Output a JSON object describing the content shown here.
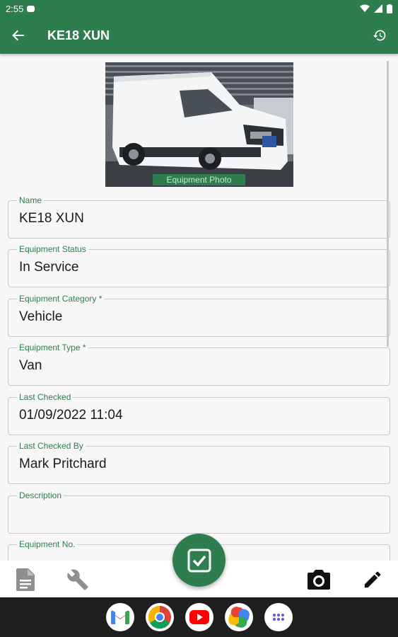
{
  "status_bar": {
    "time": "2:55"
  },
  "app_bar": {
    "title": "KE18 XUN"
  },
  "photo": {
    "caption": "Equipment Photo"
  },
  "fields": [
    {
      "label": "Name",
      "value": "KE18 XUN"
    },
    {
      "label": "Equipment Status",
      "value": "In Service"
    },
    {
      "label": "Equipment Category *",
      "value": "Vehicle"
    },
    {
      "label": "Equipment Type *",
      "value": "Van"
    },
    {
      "label": "Last Checked",
      "value": "01/09/2022 11:04"
    },
    {
      "label": "Last Checked By",
      "value": "Mark Pritchard"
    },
    {
      "label": "Description",
      "value": ""
    },
    {
      "label": "Equipment No.",
      "value": ""
    }
  ],
  "bottom_bar": {
    "icons": [
      "document-icon",
      "wrench-icon",
      "camera-icon",
      "pencil-icon"
    ]
  },
  "fab": {
    "icon": "checkbox-icon"
  },
  "nav_apps": [
    "gmail-icon",
    "chrome-icon",
    "youtube-icon",
    "photos-icon",
    "app-drawer-icon"
  ],
  "colors": {
    "primary": "#2e7d4e",
    "label": "#2e7d4e",
    "background": "#f7f7f7"
  }
}
